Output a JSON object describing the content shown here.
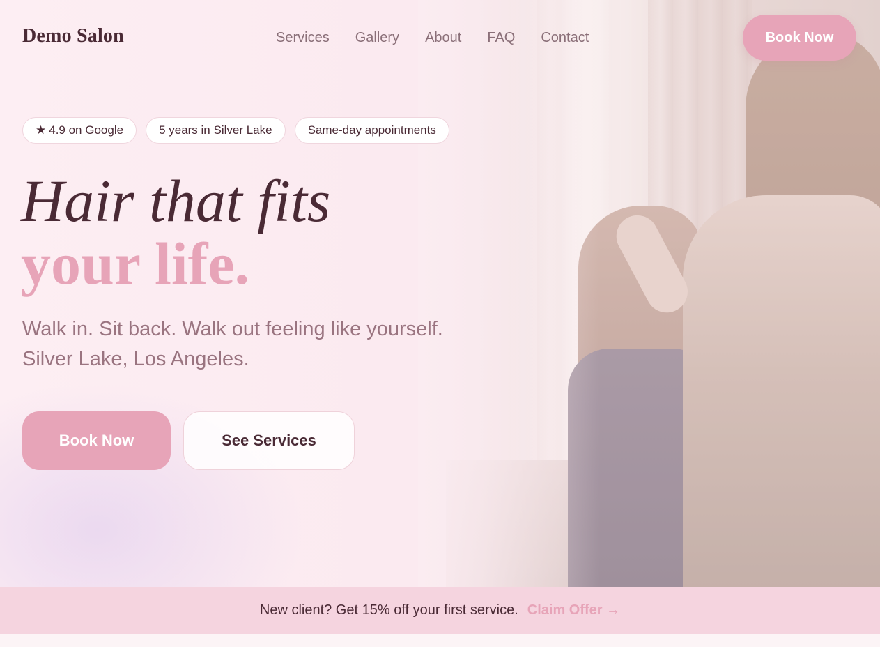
{
  "brand": {
    "name": "Demo Salon"
  },
  "nav": {
    "items": [
      {
        "label": "Services"
      },
      {
        "label": "Gallery"
      },
      {
        "label": "About"
      },
      {
        "label": "FAQ"
      },
      {
        "label": "Contact"
      }
    ],
    "cta_label": "Book Now"
  },
  "badges": [
    {
      "icon": "star-icon",
      "label": "4.9 on Google",
      "glyph": "★"
    },
    {
      "label": "5 years in Silver Lake"
    },
    {
      "label": "Same-day appointments"
    }
  ],
  "hero": {
    "headline_line1": "Hair that fits",
    "headline_line2": "your life.",
    "subtitle_line1": "Walk in. Sit back. Walk out feeling like yourself.",
    "subtitle_line2": "Silver Lake, Los Angeles.",
    "primary_cta": "Book Now",
    "secondary_cta": "See Services",
    "image_icon": "salon-photo"
  },
  "banner": {
    "text": "New client? Get 15% off your first service.",
    "link_label": "Claim Offer →"
  },
  "colors": {
    "accent": "#e7a4b8",
    "text_dark": "#4a2a35",
    "text_muted": "#9a7480",
    "banner_bg": "#f5d4df",
    "page_bg": "#fdf1f4"
  }
}
